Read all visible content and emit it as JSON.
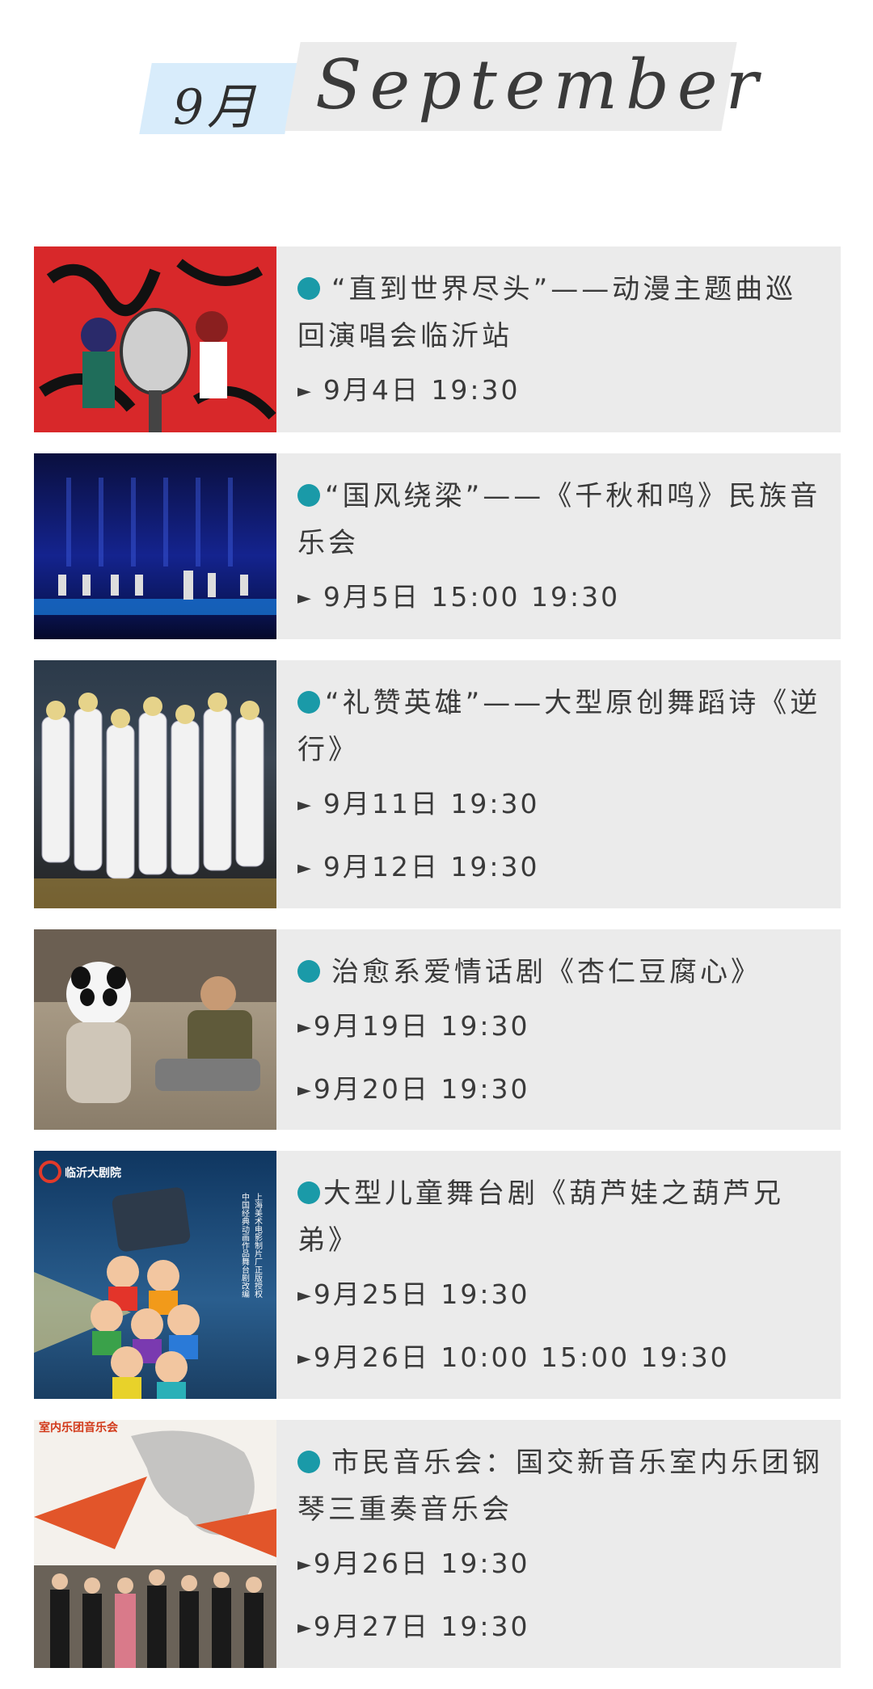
{
  "header": {
    "month_cn": "9月",
    "month_en": "September"
  },
  "events": [
    {
      "title": "“直到世界尽头”——动漫主题曲巡回演唱会临沂站",
      "dates": [
        "9月4日 19:30"
      ]
    },
    {
      "title": "“国风绕梁”——《千秋和鸣》民族音乐会",
      "dates": [
        "9月5日 15:00 19:30"
      ]
    },
    {
      "title": "“礼赞英雄”——大型原创舞蹈诗《逆行》",
      "dates": [
        "9月11日 19:30",
        "9月12日 19:30"
      ]
    },
    {
      "title": "治愈系爱情话剧《杏仁豆腐心》",
      "dates": [
        "9月19日 19:30",
        "9月20日 19:30"
      ]
    },
    {
      "title": "大型儿童舞台剧《葫芦娃之葫芦兄弟》",
      "dates": [
        "9月25日 19:30",
        "9月26日 10:00 15:00 19:30"
      ],
      "poster_text": {
        "brand": "临沂大剧院",
        "vertical_1": "上海美术电影制片厂正版授权",
        "vertical_2": "中国经典动画作品舞台剧改编"
      }
    },
    {
      "title": "市民音乐会：国交新音乐室内乐团钢琴三重奏音乐会",
      "dates": [
        "9月26日 19:30",
        "9月27日 19:30"
      ],
      "poster_text": {
        "banner": "室内乐团音乐会"
      }
    }
  ],
  "colors": {
    "dot": "#1a9aa8",
    "card_bg": "#ebebeb",
    "header_cn_bg": "#d8ecfb",
    "header_en_bg": "#ebebeb"
  }
}
